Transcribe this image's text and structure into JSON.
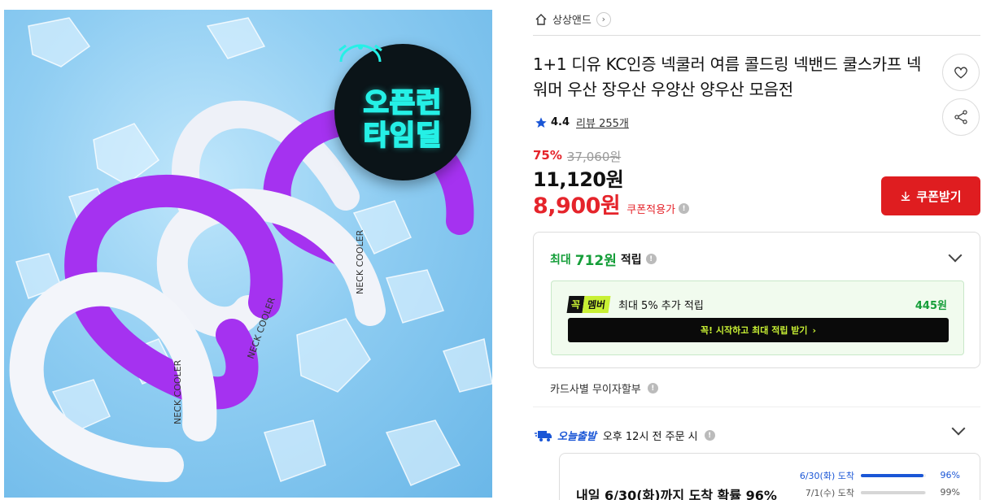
{
  "image": {
    "badge_line1": "오픈런",
    "badge_line2": "타임딜",
    "product_print": "NECK COOLER",
    "colors": {
      "background": "#8fcdf2",
      "purple_ring": "#a532f0",
      "white_ring": "#e9eef7",
      "badge_neon": "#25f0e6"
    }
  },
  "breadcrumb": {
    "store": "상상앤드"
  },
  "product": {
    "title": "1+1 디유 KC인증 넥쿨러 여름 콜드링 넥밴드 쿨스카프 넥워머 우산 장우산 우양산 양우산 모음전",
    "rating": "4.4",
    "reviews": "리뷰 255개"
  },
  "pricing": {
    "discount": "75%",
    "original": "37,060원",
    "price": "11,120원",
    "coupon_price": "8,900원",
    "coupon_label": "쿠폰적용가",
    "coupon_button": "쿠폰받기",
    "accent": "#df1d20"
  },
  "reward": {
    "prefix": "최대",
    "amount": "712원",
    "suffix": "적립",
    "member_k": "꼭",
    "member_m": "멤버",
    "member_text": "최대 5% 추가 적립",
    "member_amount": "445원",
    "member_cta": "꼭! 시작하고 최대 적립 받기",
    "accent": "#159e39"
  },
  "installment": {
    "label": "카드사별 무이자할부"
  },
  "shipping": {
    "brand": "오늘출발",
    "text": "오후 12시 전 주문 시",
    "arrival_title": "내일 6/30(화)까지 도착 확률 96%",
    "rows": [
      {
        "day": "6/30(화) 도착",
        "pct": "96%",
        "value": 0.96,
        "color": "#1a56d6"
      },
      {
        "day": "7/1(수) 도착",
        "pct": "99%",
        "value": 0.99,
        "color": "#d6d6d6"
      }
    ]
  }
}
